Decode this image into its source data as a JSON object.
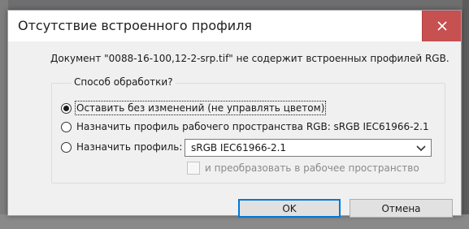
{
  "dialog": {
    "title": "Отсутствие встроенного профиля",
    "message": "Документ \"0088-16-100,12-2-srp.tif\" не содержит встроенных профилей RGB.",
    "group_label": "Способ обработки?",
    "options": [
      {
        "label": "Оставить без изменений (не управлять цветом)",
        "selected": true
      },
      {
        "label": "Назначить профиль рабочего пространства RGB:  sRGB IEC61966-2.1",
        "selected": false
      },
      {
        "label": "Назначить профиль:",
        "selected": false
      }
    ],
    "profile_select": {
      "value": "sRGB IEC61966-2.1"
    },
    "convert_checkbox": {
      "label": "и преобразовать в рабочее пространство",
      "checked": false,
      "enabled": false
    },
    "buttons": {
      "ok": "OK",
      "cancel": "Отмена"
    }
  },
  "colors": {
    "close_button": "#c75050",
    "dialog_body": "#f0f0f0",
    "default_button_border": "#0078d7"
  },
  "icons": {
    "close": "close-icon",
    "select_arrow": "chevron-down-icon"
  }
}
